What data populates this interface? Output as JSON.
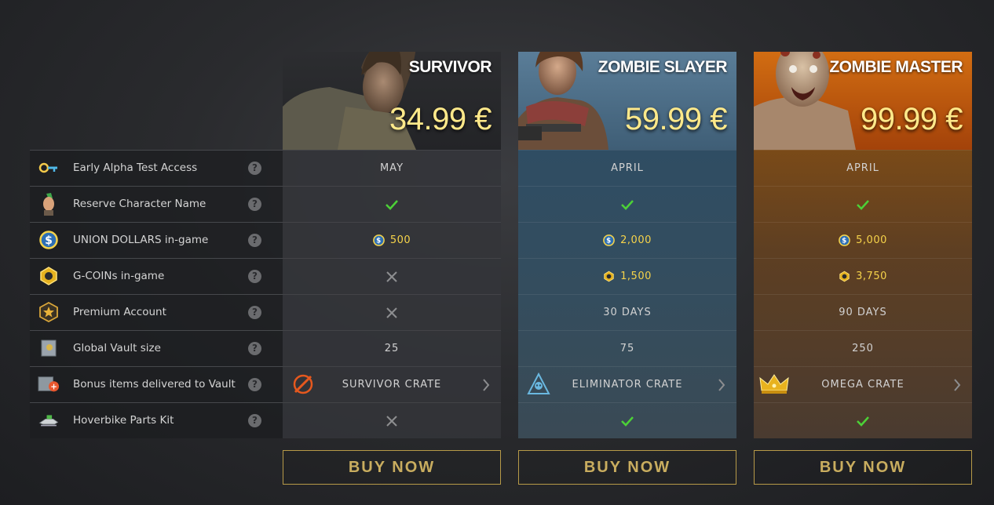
{
  "features": [
    {
      "label": "Early Alpha Test Access",
      "icon": "key-icon"
    },
    {
      "label": "Reserve Character Name",
      "icon": "character-icon"
    },
    {
      "label": "UNION DOLLARS in-game",
      "icon": "union-dollar-icon"
    },
    {
      "label": "G-COINs in-game",
      "icon": "g-coin-icon"
    },
    {
      "label": "Premium Account",
      "icon": "premium-star-icon"
    },
    {
      "label": "Global Vault size",
      "icon": "vault-icon"
    },
    {
      "label": "Bonus items delivered to Vault",
      "icon": "bonus-items-icon"
    },
    {
      "label": "Hoverbike Parts Kit",
      "icon": "hoverbike-icon"
    }
  ],
  "help_glyph": "?",
  "tiers": [
    {
      "name": "SURVIVOR",
      "price": "34.99 €",
      "color": "#2c2d30",
      "alpha_access": "MAY",
      "reserve_name": "check",
      "union_dollars": "500",
      "g_coins": "cross",
      "premium": "cross",
      "vault_size": "25",
      "crate": "SURVIVOR CRATE",
      "hoverbike": "cross",
      "buy_label": "BUY NOW"
    },
    {
      "name": "ZOMBIE SLAYER",
      "price": "59.99 €",
      "color": "#4f7390",
      "alpha_access": "APRIL",
      "reserve_name": "check",
      "union_dollars": "2,000",
      "g_coins": "1,500",
      "premium": "30 DAYS",
      "vault_size": "75",
      "crate": "ELIMINATOR CRATE",
      "hoverbike": "check",
      "buy_label": "BUY NOW"
    },
    {
      "name": "ZOMBIE MASTER",
      "price": "99.99 €",
      "color": "#c55a0e",
      "alpha_access": "APRIL",
      "reserve_name": "check",
      "union_dollars": "5,000",
      "g_coins": "3,750",
      "premium": "90 DAYS",
      "vault_size": "250",
      "crate": "OMEGA CRATE",
      "hoverbike": "check",
      "buy_label": "BUY NOW"
    }
  ],
  "colors": {
    "gold_text": "#f6d34a",
    "price_text": "#ffe98a",
    "check_green": "#4cd137",
    "buy_border": "#b79a48"
  }
}
